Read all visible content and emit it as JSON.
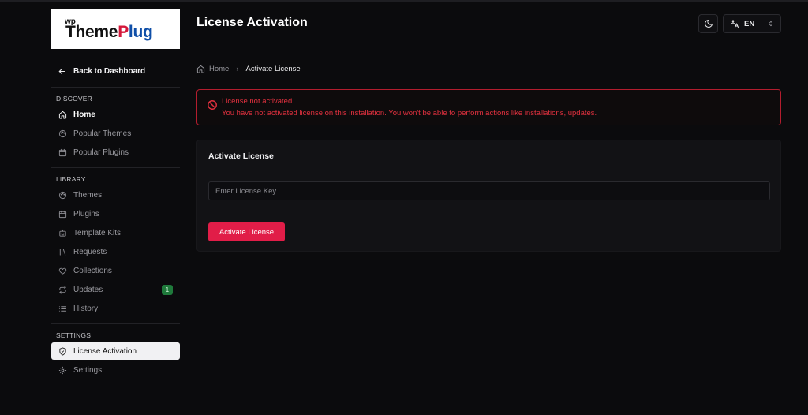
{
  "logo": {
    "prefix": "wp",
    "theme": "Theme",
    "plug_cap": "P",
    "plug_rest": "lug"
  },
  "sidebar": {
    "back_label": "Back to Dashboard",
    "discover": {
      "title": "DISCOVER",
      "items": [
        {
          "label": "Home",
          "icon": "home-icon"
        },
        {
          "label": "Popular Themes",
          "icon": "palette-icon"
        },
        {
          "label": "Popular Plugins",
          "icon": "calendar-icon"
        }
      ]
    },
    "library": {
      "title": "LIBRARY",
      "items": [
        {
          "label": "Themes",
          "icon": "palette-icon"
        },
        {
          "label": "Plugins",
          "icon": "calendar-icon"
        },
        {
          "label": "Template Kits",
          "icon": "bot-icon"
        },
        {
          "label": "Requests",
          "icon": "library-icon"
        },
        {
          "label": "Collections",
          "icon": "heart-icon"
        },
        {
          "label": "Updates",
          "icon": "repeat-icon",
          "badge": "1"
        },
        {
          "label": "History",
          "icon": "list-icon"
        }
      ]
    },
    "settings": {
      "title": "SETTINGS",
      "items": [
        {
          "label": "License Activation",
          "icon": "shield-icon"
        },
        {
          "label": "Settings",
          "icon": "gear-icon"
        }
      ]
    }
  },
  "header": {
    "title": "License Activation",
    "language": "EN"
  },
  "breadcrumb": {
    "home": "Home",
    "current": "Activate License"
  },
  "alert": {
    "title": "License not activated",
    "message": "You have not activated license on this installation. You won't be able to perform actions like installations, updates."
  },
  "card": {
    "title": "Activate License",
    "input_placeholder": "Enter License Key",
    "input_value": "",
    "button_label": "Activate License"
  },
  "colors": {
    "accent": "#e11d48",
    "alert": "#e3313f",
    "badge": "#1f7a3b"
  }
}
